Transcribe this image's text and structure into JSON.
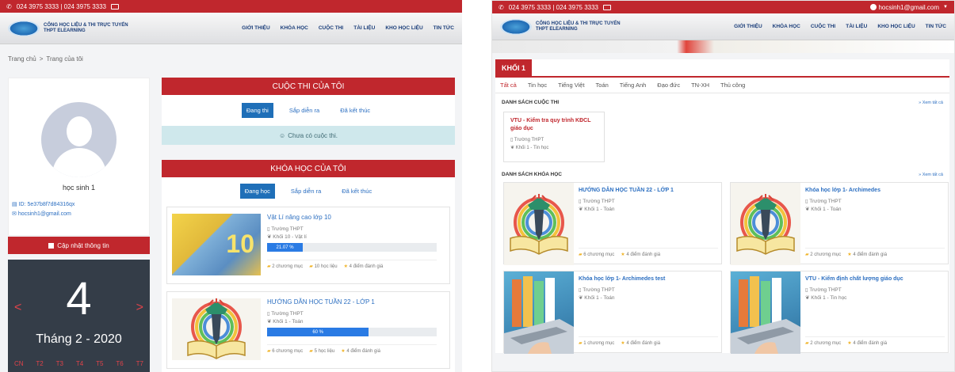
{
  "shared": {
    "phone": "024 3975 3333 | 024 3975 3333",
    "email": "hocsinh1@gmail.com",
    "logo_line1": "CỔNG HỌC LIỆU & THI TRỰC TUYẾN",
    "logo_line2": "THPT ELEARNING",
    "nav": [
      "GIỚI THIỆU",
      "KHÓA HỌC",
      "CUỘC THI",
      "TÀI LIỆU",
      "KHO HỌC LIỆU",
      "TIN TỨC"
    ]
  },
  "left": {
    "breadcrumb": [
      "Trang chủ",
      "Trang của tôi"
    ],
    "profile": {
      "name": "học sinh 1",
      "id_text": "ID: 5e37b8f7d84316qx",
      "email_text": "hocsinh1@gmail.com",
      "update_label": "Cập nhật thông tin"
    },
    "calendar": {
      "day": "4",
      "month": "Tháng 2 - 2020",
      "prev": "<",
      "next": ">",
      "weekdays": [
        "CN",
        "T2",
        "T3",
        "T4",
        "T5",
        "T6",
        "T7"
      ]
    },
    "contests": {
      "title": "CUỘC THI CỦA TÔI",
      "tabs": [
        "Đang thi",
        "Sắp diễn ra",
        "Đã kết thúc"
      ],
      "empty": "Chưa có cuộc thi."
    },
    "courses": {
      "title": "KHÓA HỌC CỦA TÔI",
      "tabs": [
        "Đang học",
        "Sắp diễn ra",
        "Đã kết thúc"
      ],
      "items": [
        {
          "title": "Vật Lí nâng cao lớp 10",
          "school": "Trường THPT",
          "grade": "Khối 10 - Vật lí",
          "progress": 21.07,
          "progress_label": "21.07 %",
          "chapters": "2 chương mục",
          "docs": "10 học liệu",
          "rating": "4 điểm đánh giá",
          "thumb_text": "10"
        },
        {
          "title": "HƯỚNG DẪN HỌC TUẦN 22 - LỚP 1",
          "school": "Trường THPT",
          "grade": "Khối 1 - Toán",
          "progress": 60,
          "progress_label": "60 %",
          "chapters": "6 chương mục",
          "docs": "5 học liệu",
          "rating": "4 điểm đánh giá"
        }
      ]
    }
  },
  "right": {
    "grade_tab": "KHỐI 1",
    "subjects": [
      "Tất cả",
      "Tin học",
      "Tiếng Việt",
      "Toán",
      "Tiếng Anh",
      "Đạo đức",
      "TN-XH",
      "Thủ công"
    ],
    "contest_section": "DANH SÁCH CUỘC THI",
    "course_section": "DANH SÁCH KHÓA HỌC",
    "see_all": "» Xem tất cả",
    "contest_card": {
      "title": "VTU - Kiểm tra quy trình KĐCL giáo dục",
      "school": "Trường THPT",
      "grade": "Khối 1 - Tin học"
    },
    "courses": [
      {
        "title": "HƯỚNG DẪN HỌC TUẦN 22 - LỚP 1",
        "school": "Trường THPT",
        "grade": "Khối 1 - Toán",
        "chapters": "6 chương mục",
        "rating": "4 điểm đánh giá",
        "thumb": "pen"
      },
      {
        "title": "Khóa học lớp 1- Archimedes",
        "school": "Trường THPT",
        "grade": "Khối 1 - Toán",
        "chapters": "2 chương mục",
        "rating": "4 điểm đánh giá",
        "thumb": "pen"
      },
      {
        "title": "Khóa học lớp 1- Archimedes test",
        "school": "Trường THPT",
        "grade": "Khối 1 - Toán",
        "chapters": "1 chương mục",
        "rating": "4 điểm đánh giá",
        "thumb": "laptop"
      },
      {
        "title": "VTU - Kiểm định chất lượng giáo dục",
        "school": "Trường THPT",
        "grade": "Khối 1 - Tin học",
        "chapters": "2 chương mục",
        "rating": "4 điểm đánh giá",
        "thumb": "laptop"
      }
    ]
  },
  "colors": {
    "brand_red": "#c0272d",
    "link_blue": "#2c6fc1",
    "calendar_bg": "#343d48",
    "progress_blue": "#2a7be4"
  }
}
